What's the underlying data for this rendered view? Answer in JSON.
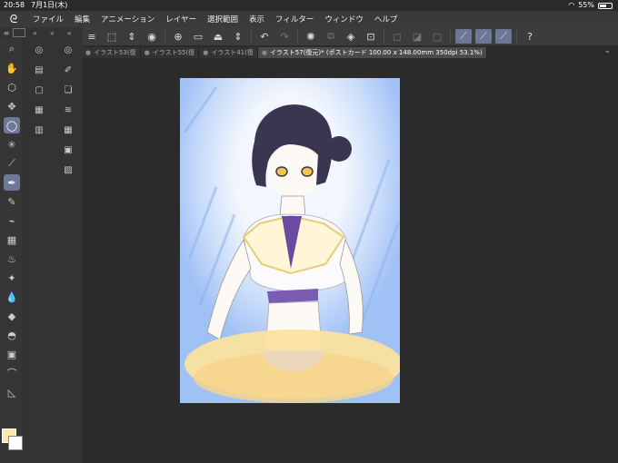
{
  "status": {
    "time": "20:58",
    "date": "7月1日(木)",
    "battery": "55%"
  },
  "menu": {
    "items": [
      "ファイル",
      "編集",
      "アニメーション",
      "レイヤー",
      "選択範囲",
      "表示",
      "フィルター",
      "ウィンドウ",
      "ヘルプ"
    ]
  },
  "tabs": [
    {
      "label": "イラスト53(復"
    },
    {
      "label": "イラスト55(復"
    },
    {
      "label": "イラスト41(復"
    },
    {
      "label": "イラスト57(復元)* (ポストカード 100.00 x 148.00mm 350dpi 53.1%)"
    }
  ],
  "colors": {
    "foreground": "#fbe8b0",
    "background": "#ffffff",
    "accent": "#6d7896"
  }
}
